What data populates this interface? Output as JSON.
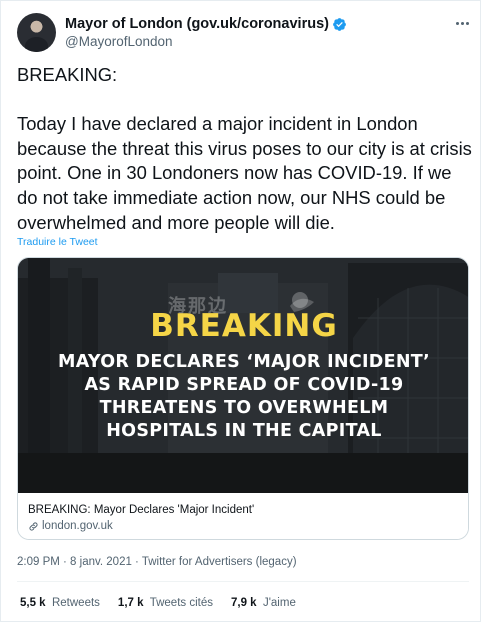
{
  "author": {
    "display_name": "Mayor of London (gov.uk/coronavirus)",
    "handle": "@MayorofLondon"
  },
  "tweet": {
    "text": "BREAKING:\n\nToday I have declared a major incident in London because the threat this virus poses to our city is at crisis point. One in 30 Londoners now has COVID-19. If we do not take immediate action now, our NHS could be overwhelmed and more people will die.",
    "translate_label": "Traduire le Tweet"
  },
  "card": {
    "image_breaking": "BREAKING",
    "image_headline": [
      "MAYOR DECLARES ‘MAJOR INCIDENT’",
      "AS RAPID SPREAD OF COVID-19",
      "THREATENS TO OVERWHELM",
      "HOSPITALS IN THE CAPITAL"
    ],
    "watermark": "海那边",
    "title": "BREAKING: Mayor Declares 'Major Incident'",
    "domain": "london.gov.uk"
  },
  "meta": {
    "timestamp": "2:09 PM · 8 janv. 2021 · Twitter for Advertisers (legacy)"
  },
  "stats": {
    "retweets_count": "5,5 k",
    "retweets_label": "Retweets",
    "quotes_count": "1,7 k",
    "quotes_label": "Tweets cités",
    "likes_count": "7,9 k",
    "likes_label": "J'aime"
  },
  "colors": {
    "accent": "#1d9bf0",
    "breaking_yellow": "#f5d547",
    "muted_text": "#536471"
  }
}
